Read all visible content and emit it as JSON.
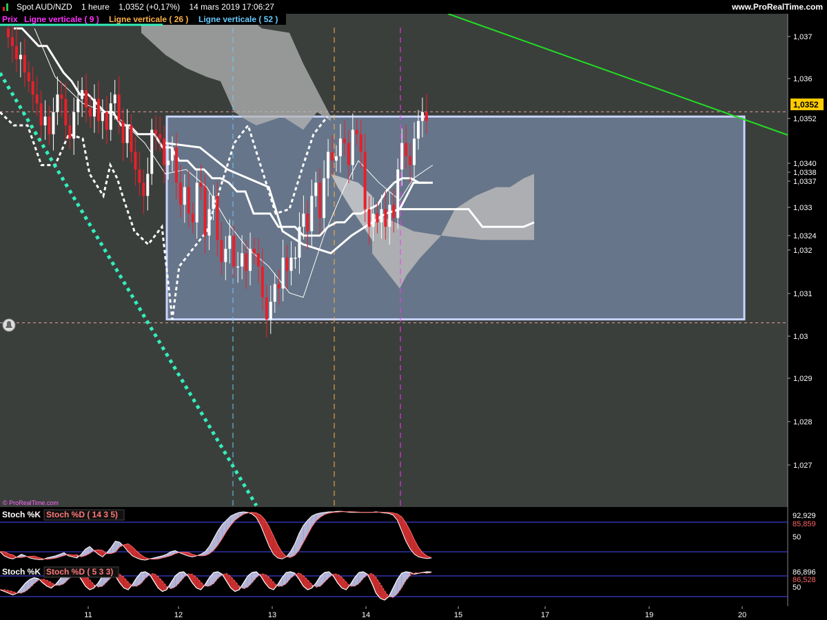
{
  "header": {
    "symbol": "Spot AUD/NZD",
    "timeframe": "1 heure",
    "price": "1,0352 (+0,17%)",
    "datetime": "14 mars 2019 17:06:27",
    "site": "www.ProRealTime.com"
  },
  "legend": {
    "prix": "Prix",
    "items": [
      {
        "label": "Ligne verticale ( 9 )",
        "color": "#ff33ff"
      },
      {
        "label": "Ligne verticale ( 26 )",
        "color": "#ffb347"
      },
      {
        "label": "Ligne verticale ( 52 )",
        "color": "#66ccff"
      }
    ]
  },
  "watermark": "© ProRealTime.com",
  "colors": {
    "background": "#3b3f3c",
    "bull": "#ffffff",
    "bear": "#e8202a",
    "trendline": "#22dd22",
    "dotted": "#33eebb",
    "box_fill": "#6f7f96",
    "box_stroke": "#c8d4ff",
    "price_badge": "#ffcc00"
  },
  "price_axis": {
    "ticks": [
      "1,037",
      "1,036",
      "1,0352",
      "1,0340",
      "1,0338",
      "1,0337",
      "1,033",
      "1,0324",
      "1,032",
      "1,031",
      "1,03",
      "1,029",
      "1,028",
      "1,027"
    ],
    "current": "1,0352"
  },
  "date_axis": {
    "labels": [
      "11",
      "12",
      "13",
      "14",
      "15",
      "17",
      "19",
      "20"
    ]
  },
  "stoch1": {
    "title": "Stoch %K",
    "param": "Stoch %D ( 14 3 5)",
    "val_k": "92,929",
    "val_d": "85,859",
    "level": "50"
  },
  "stoch2": {
    "title": "Stoch %K",
    "param": "Stoch %D ( 5 3 3)",
    "val_k": "86,896",
    "val_d": "86,528",
    "level": "50"
  },
  "chart_data": {
    "type": "candlestick",
    "title": "Spot AUD/NZD",
    "ylim": [
      1.0263,
      1.0378
    ],
    "current_price": 1.0352,
    "range_box": {
      "low": 1.0306,
      "high": 1.0352
    },
    "closes": [
      1.037,
      1.0368,
      1.0365,
      1.0366,
      1.0362,
      1.036,
      1.0357,
      1.0355,
      1.035,
      1.0352,
      1.0348,
      1.0353,
      1.0357,
      1.0356,
      1.035,
      1.0347,
      1.0353,
      1.0356,
      1.0358,
      1.0354,
      1.0352,
      1.0356,
      1.0351,
      1.0353,
      1.0349,
      1.0355,
      1.0357,
      1.0351,
      1.0346,
      1.035,
      1.0344,
      1.034,
      1.0337,
      1.0334,
      1.0339,
      1.0349,
      1.0348,
      1.0347,
      1.0341,
      1.0342,
      1.0345,
      1.0337,
      1.0332,
      1.0336,
      1.033,
      1.0328,
      1.0337,
      1.0336,
      1.0325,
      1.0331,
      1.0334,
      1.0324,
      1.0319,
      1.0322,
      1.0325,
      1.0318,
      1.0318,
      1.0321,
      1.0317,
      1.0322,
      1.0321,
      1.0318,
      1.0311,
      1.0306,
      1.031,
      1.0314,
      1.0313,
      1.032,
      1.0317,
      1.032,
      1.032,
      1.0327,
      1.033,
      1.0326,
      1.0334,
      1.0337,
      1.0329,
      1.0338,
      1.0344,
      1.0342,
      1.0343,
      1.0347,
      1.0346,
      1.0341,
      1.0349,
      1.0348,
      1.0344,
      1.0331,
      1.0327,
      1.033,
      1.0328,
      1.0331,
      1.0327,
      1.0332,
      1.0329,
      1.034,
      1.0346,
      1.0343,
      1.0341,
      1.0347,
      1.0351,
      1.0353,
      1.0351
    ],
    "kijun": [
      1.0372,
      1.0372,
      1.037,
      1.0368,
      1.0368,
      1.0365,
      1.0362,
      1.036,
      1.0357,
      1.0357,
      1.0355,
      1.0353,
      1.0353,
      1.035,
      1.035,
      1.0348,
      1.0348,
      1.0348,
      1.0345,
      1.0345,
      1.0342,
      1.0342,
      1.034,
      1.034,
      1.0338,
      1.0338,
      1.0337,
      1.0335,
      1.0335,
      1.033,
      1.033,
      1.033,
      1.0327,
      1.0327,
      1.0327,
      1.0325,
      1.0325,
      1.0325,
      1.0327,
      1.0328,
      1.0328,
      1.033,
      1.033,
      1.0331,
      1.0332,
      1.0335,
      1.0337,
      1.0338,
      1.0338,
      1.0337,
      1.0337
    ]
  }
}
